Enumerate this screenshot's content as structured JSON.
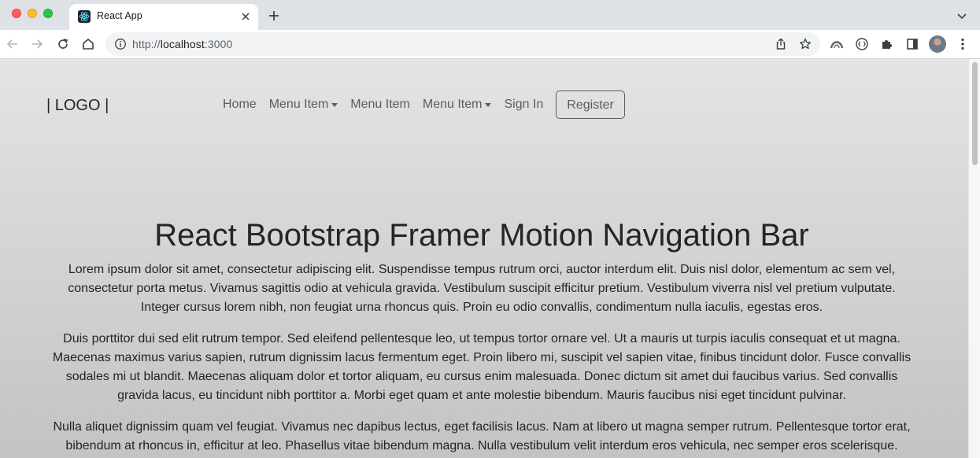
{
  "browser": {
    "tab_title": "React App",
    "url_prefix": "http://",
    "url_host": "localhost",
    "url_suffix": ":3000"
  },
  "navbar": {
    "logo": "| LOGO |",
    "items": [
      {
        "label": "Home",
        "dropdown": false
      },
      {
        "label": "Menu Item",
        "dropdown": true
      },
      {
        "label": "Menu Item",
        "dropdown": false
      },
      {
        "label": "Menu Item",
        "dropdown": true
      },
      {
        "label": "Sign In",
        "dropdown": false
      }
    ],
    "register_label": "Register"
  },
  "content": {
    "title": "React Bootstrap Framer Motion Navigation Bar",
    "paragraphs": [
      [
        "Lorem ipsum dolor sit amet, consectetur adipiscing elit. Suspendisse tempus rutrum orci, auctor interdum elit. Duis nisl dolor, elementum ac sem vel,",
        "consectetur porta metus. Vivamus sagittis odio at vehicula gravida. Vestibulum suscipit efficitur pretium. Vestibulum viverra nisl vel pretium vulputate.",
        "Integer cursus lorem nibh, non feugiat urna rhoncus quis. Proin eu odio convallis, condimentum nulla iaculis, egestas eros."
      ],
      [
        "Duis porttitor dui sed elit rutrum tempor. Sed eleifend pellentesque leo, ut tempus tortor ornare vel. Ut a mauris ut turpis iaculis consequat et ut magna.",
        "Maecenas maximus varius sapien, rutrum dignissim lacus fermentum eget. Proin libero mi, suscipit vel sapien vitae, finibus tincidunt dolor. Fusce convallis",
        "sodales mi ut blandit. Maecenas aliquam dolor et tortor aliquam, eu cursus enim malesuada. Donec dictum sit amet dui faucibus varius. Sed convallis",
        "gravida lacus, eu tincidunt nibh porttitor a. Morbi eget quam et ante molestie bibendum. Mauris faucibus nisi eget tincidunt pulvinar."
      ],
      [
        "Nulla aliquet dignissim quam vel feugiat. Vivamus nec dapibus lectus, eget facilisis lacus. Nam at libero ut magna semper rutrum. Pellentesque tortor erat,",
        "bibendum at rhoncus in, efficitur at leo. Phasellus vitae bibendum magna. Nulla vestibulum velit interdum eros vehicula, nec semper eros scelerisque."
      ]
    ]
  },
  "colors": {
    "nav_link": "#5c5c5c",
    "text": "#212529",
    "background_top": "#e4e4e4",
    "background_bottom": "#c3c3c3"
  }
}
